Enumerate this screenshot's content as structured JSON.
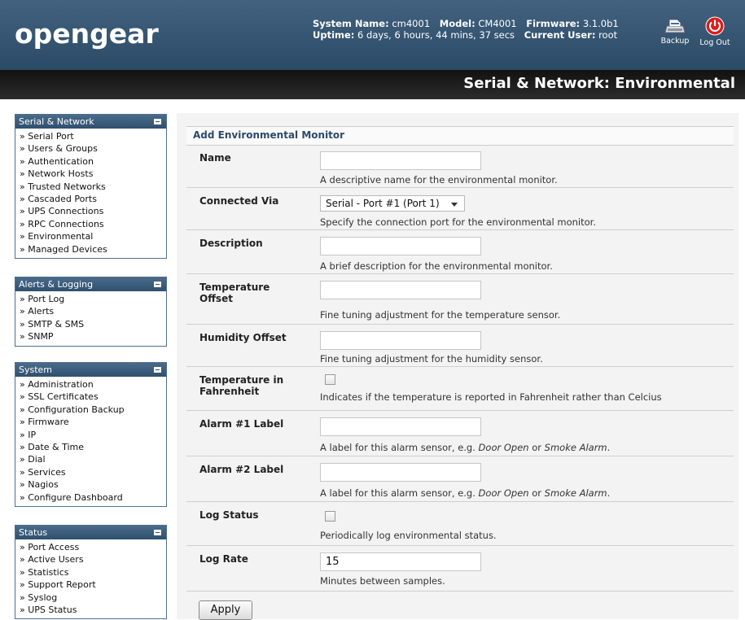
{
  "header": {
    "logo": "opengear",
    "system_name_label": "System Name:",
    "system_name": "cm4001",
    "model_label": "Model:",
    "model": "CM4001",
    "firmware_label": "Firmware:",
    "firmware": "3.1.0b1",
    "uptime_label": "Uptime:",
    "uptime": "6 days, 6 hours, 44 mins, 37 secs",
    "current_user_label": "Current User:",
    "current_user": "root",
    "backup_label": "Backup",
    "logout_label": "Log Out",
    "page_title": "Serial & Network: Environmental"
  },
  "sidebar": {
    "sections": [
      {
        "title": "Serial & Network",
        "items": [
          "» Serial Port",
          "» Users & Groups",
          "» Authentication",
          "» Network Hosts",
          "» Trusted Networks",
          "» Cascaded Ports",
          "» UPS Connections",
          "» RPC Connections",
          "» Environmental",
          "» Managed Devices"
        ]
      },
      {
        "title": "Alerts & Logging",
        "items": [
          "» Port Log",
          "» Alerts",
          "» SMTP & SMS",
          "» SNMP"
        ]
      },
      {
        "title": "System",
        "items": [
          "» Administration",
          "» SSL Certificates",
          "» Configuration Backup",
          "» Firmware",
          "» IP",
          "» Date & Time",
          "» Dial",
          "» Services",
          "» Nagios",
          "» Configure Dashboard"
        ]
      },
      {
        "title": "Status",
        "items": [
          "» Port Access",
          "» Active Users",
          "» Statistics",
          "» Support Report",
          "» Syslog",
          "» UPS Status"
        ]
      }
    ]
  },
  "form": {
    "title": "Add Environmental Monitor",
    "name": {
      "label": "Name",
      "value": "",
      "help": "A descriptive name for the environmental monitor."
    },
    "connected_via": {
      "label": "Connected Via",
      "value": "Serial - Port #1 (Port 1)",
      "help": "Specify the connection port for the environmental monitor."
    },
    "description": {
      "label": "Description",
      "value": "",
      "help": "A brief description for the environmental monitor."
    },
    "temperature_offset": {
      "label_line1": "Temperature",
      "label_line2": "Offset",
      "value": "",
      "help": "Fine tuning adjustment for the temperature sensor."
    },
    "humidity_offset": {
      "label": "Humidity Offset",
      "value": "",
      "help": "Fine tuning adjustment for the humidity sensor."
    },
    "temperature_fahrenheit": {
      "label_line1": "Temperature in",
      "label_line2": "Fahrenheit",
      "checked": false,
      "help": "Indicates if the temperature is reported in Fahrenheit rather than Celcius"
    },
    "alarm1": {
      "label": "Alarm #1 Label",
      "value": "",
      "help_prefix": "A label for this alarm sensor, e.g. ",
      "help_ex1": "Door Open",
      "help_or": " or ",
      "help_ex2": "Smoke Alarm",
      "help_end": "."
    },
    "alarm2": {
      "label": "Alarm #2 Label",
      "value": "",
      "help_prefix": "A label for this alarm sensor, e.g. ",
      "help_ex1": "Door Open",
      "help_or": " or ",
      "help_ex2": "Smoke Alarm",
      "help_end": "."
    },
    "log_status": {
      "label": "Log Status",
      "checked": false,
      "help": "Periodically log environmental status."
    },
    "log_rate": {
      "label": "Log Rate",
      "value": "15",
      "help": "Minutes between samples."
    },
    "apply_label": "Apply"
  },
  "colors": {
    "header_blue": "#2b4a66",
    "title_bar": "#1a1a1a",
    "accent_text": "#2c4a6b",
    "logout_red": "#d81e1e"
  }
}
